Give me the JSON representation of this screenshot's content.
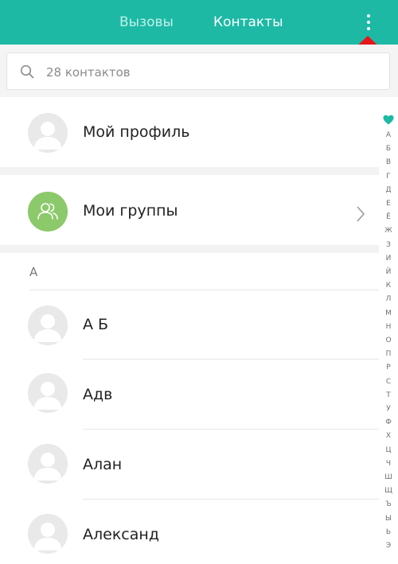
{
  "tabs": {
    "calls": "Вызовы",
    "contacts": "Контакты"
  },
  "search": {
    "placeholder": "28 контактов"
  },
  "profile": {
    "label": "Мой профиль"
  },
  "groups": {
    "label": "Мои группы"
  },
  "section": {
    "letter": "А"
  },
  "contacts": [
    {
      "name": "А Б"
    },
    {
      "name": "Адв"
    },
    {
      "name": "Алан"
    },
    {
      "name": "Александ"
    }
  ],
  "index": {
    "letters": [
      "А",
      "Б",
      "В",
      "Г",
      "Д",
      "Е",
      "Ё",
      "Ж",
      "З",
      "И",
      "Й",
      "К",
      "Л",
      "М",
      "Н",
      "О",
      "П",
      "Р",
      "С",
      "Т",
      "У",
      "Ф",
      "Х",
      "Ц",
      "Ч",
      "Ш",
      "Щ",
      "Ъ",
      "Ы",
      "Ь",
      "Э"
    ]
  },
  "colors": {
    "accent": "#1db9a5",
    "tab_inactive": "#bff0e8",
    "group_avatar": "#8cc96a",
    "arrow_red": "#e8141b",
    "heart": "#1db9a5"
  },
  "icons": {
    "menu": "more-vertical-icon",
    "search": "search-icon",
    "groups": "people-icon",
    "chevron": "chevron-right-icon",
    "favorites": "heart-icon"
  }
}
